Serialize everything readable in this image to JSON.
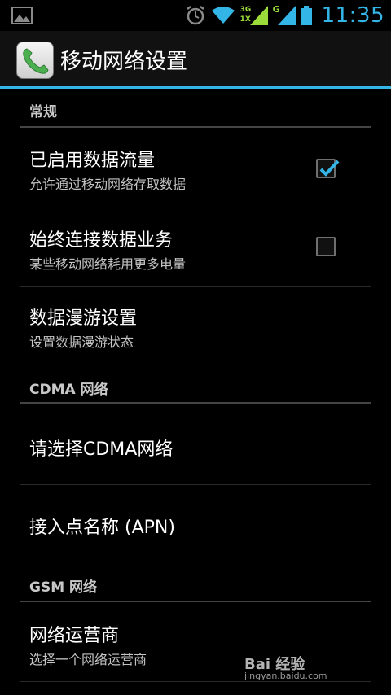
{
  "status_bar": {
    "time": "11:35",
    "net_3g_top": "3G",
    "net_3g_bottom": "1X",
    "net_g": "G",
    "accent_color": "#33b5e5"
  },
  "action_bar": {
    "title": "移动网络设置",
    "icon": "phone-icon"
  },
  "sections": {
    "general": {
      "header": "常规",
      "items": [
        {
          "title": "已启用数据流量",
          "subtitle": "允许通过移动网络存取数据",
          "checked": true
        },
        {
          "title": "始终连接数据业务",
          "subtitle": "某些移动网络耗用更多电量",
          "checked": false
        },
        {
          "title": "数据漫游设置",
          "subtitle": "设置数据漫游状态"
        }
      ]
    },
    "cdma": {
      "header": "CDMA 网络",
      "items": [
        {
          "title": "请选择CDMA网络"
        },
        {
          "title": "接入点名称 (APN)"
        }
      ]
    },
    "gsm": {
      "header": "GSM 网络",
      "items": [
        {
          "title": "网络运营商",
          "subtitle": "选择一个网络运营商"
        }
      ]
    }
  },
  "watermark": {
    "main": "Bai 经验",
    "sub": "jingyan.baidu.com"
  }
}
